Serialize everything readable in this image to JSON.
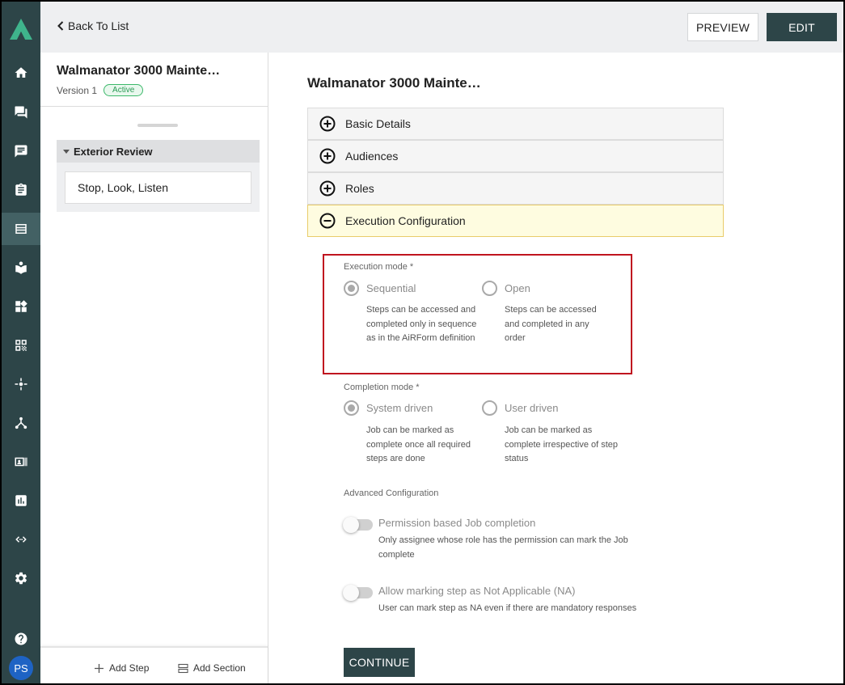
{
  "header": {
    "back_label": "Back To List",
    "preview_label": "PREVIEW",
    "edit_label": "EDIT"
  },
  "nav": {
    "items": [
      "home-icon",
      "chat-icon",
      "message-icon",
      "clipboard-icon",
      "form-icon",
      "book-icon",
      "widgets-icon",
      "qr-code-icon",
      "hub-icon",
      "network-icon",
      "id-card-icon",
      "report-icon",
      "code-icon",
      "gear-icon"
    ],
    "active": "form-icon",
    "avatar_initials": "PS",
    "accent_color": "#2d4548"
  },
  "left_panel": {
    "title": "Walmanator 3000 Mainte…",
    "version": "Version 1",
    "status_badge": "Active",
    "section_title": "Exterior Review",
    "steps": [
      "Stop, Look, Listen"
    ],
    "add_step_label": "Add Step",
    "add_section_label": "Add Section"
  },
  "main": {
    "title": "Walmanator 3000 Mainte…",
    "accordions": [
      {
        "label": "Basic Details",
        "expanded": false
      },
      {
        "label": "Audiences",
        "expanded": false
      },
      {
        "label": "Roles",
        "expanded": false
      },
      {
        "label": "Execution Configuration",
        "expanded": true
      }
    ],
    "execution_mode": {
      "label": "Execution mode *",
      "options": [
        {
          "label": "Sequential",
          "selected": true,
          "description": "Steps can be accessed and completed only in sequence as in the AiRForm definition"
        },
        {
          "label": "Open",
          "selected": false,
          "description": "Steps can be accessed and completed in any order"
        }
      ]
    },
    "completion_mode": {
      "label": "Completion mode *",
      "options": [
        {
          "label": "System driven",
          "selected": true,
          "description": "Job can be marked as complete once all required steps are done"
        },
        {
          "label": "User driven",
          "selected": false,
          "description": "Job can be marked as complete irrespective of step status"
        }
      ]
    },
    "advanced": {
      "label": "Advanced Configuration",
      "toggles": [
        {
          "label": "Permission based Job completion",
          "enabled": false,
          "description": "Only assignee whose role has the permission can mark the Job complete"
        },
        {
          "label": "Allow marking step as Not Applicable (NA)",
          "enabled": false,
          "description": "User can mark step as NA even if there are mandatory responses"
        }
      ]
    },
    "continue_label": "CONTINUE"
  }
}
